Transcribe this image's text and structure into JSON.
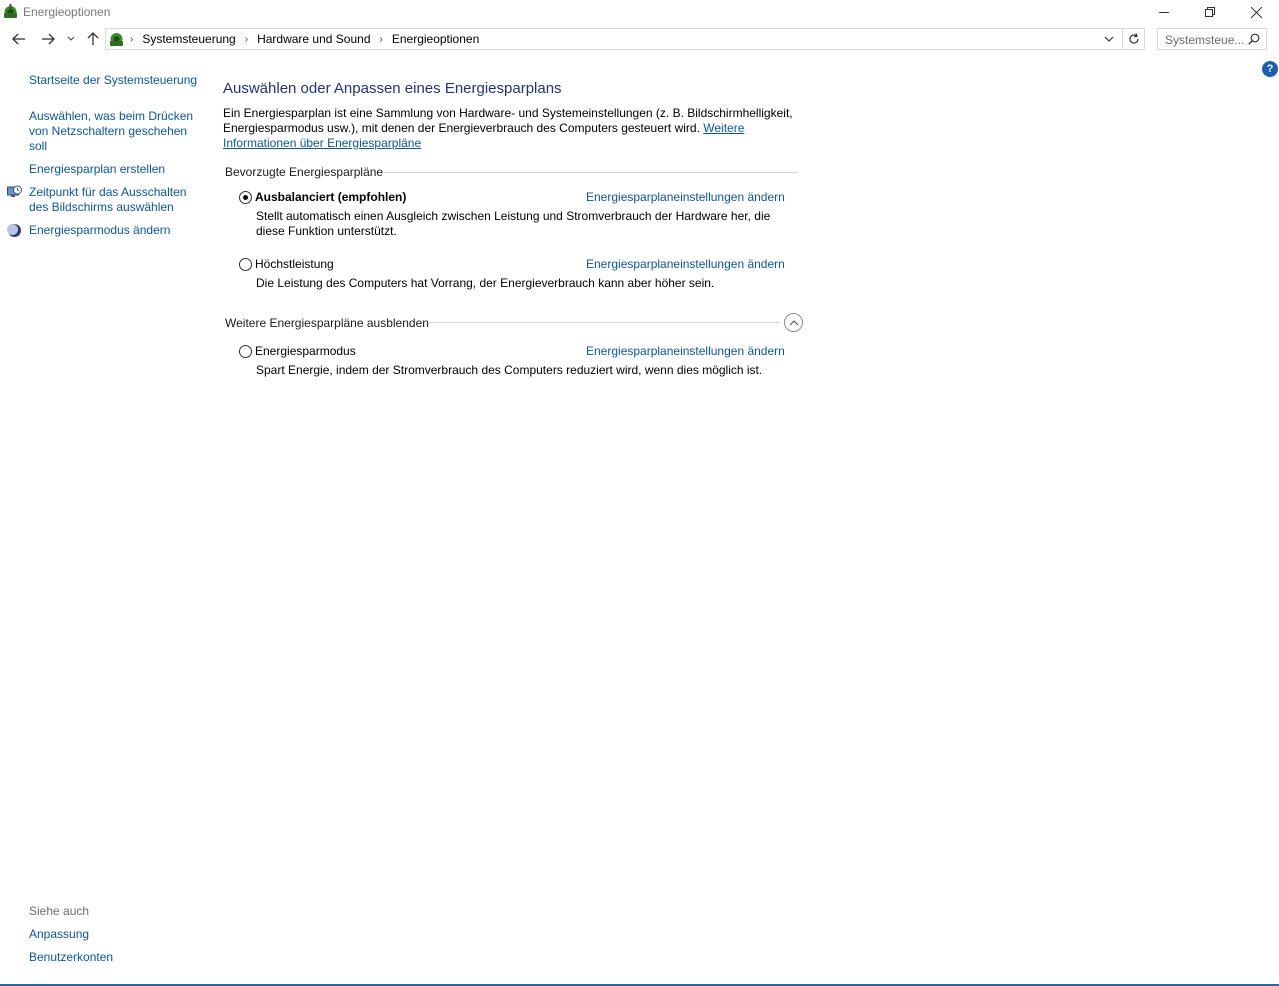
{
  "window": {
    "title": "Energieoptionen",
    "buttons": [
      "minimize",
      "restore",
      "close"
    ]
  },
  "address": {
    "crumbs": [
      "Systemsteuerung",
      "Hardware und Sound",
      "Energieoptionen"
    ]
  },
  "search": {
    "placeholder": "Systemsteue..."
  },
  "help": {
    "label": "?"
  },
  "sidebar": {
    "home": "Startseite der Systemsteuerung",
    "tasks": [
      {
        "label": "Auswählen, was beim Drücken von Netzschaltern geschehen soll",
        "icon": ""
      },
      {
        "label": "Energiesparplan erstellen",
        "icon": ""
      },
      {
        "label": "Zeitpunkt für das Ausschalten des Bildschirms auswählen",
        "icon": "monitor-clock-icon"
      },
      {
        "label": "Energiesparmodus ändern",
        "icon": "moon-icon"
      }
    ],
    "see_also": {
      "heading": "Siehe auch",
      "links": [
        "Anpassung",
        "Benutzerkonten"
      ]
    }
  },
  "main": {
    "title": "Auswählen oder Anpassen eines Energiesparplans",
    "intro": "Ein Energiesparplan ist eine Sammlung von Hardware- und Systemeinstellungen (z. B. Bildschirmhelligkeit, Energiesparmodus usw.), mit denen der Energieverbrauch des Computers gesteuert wird.",
    "intro_link": "Weitere Informationen über Energiesparpläne",
    "preferred_heading": "Bevorzugte Energiesparpläne",
    "more_heading": "Weitere Energiesparpläne ausblenden",
    "plans": [
      {
        "name": "Ausbalanciert (empfohlen)",
        "selected": true,
        "link": "Energiesparplaneinstellungen ändern",
        "desc": "Stellt automatisch einen Ausgleich zwischen Leistung und Stromverbrauch der Hardware her, die diese Funktion unterstützt."
      },
      {
        "name": "Höchstleistung",
        "selected": false,
        "link": "Energiesparplaneinstellungen ändern",
        "desc": "Die Leistung des Computers hat Vorrang, der Energieverbrauch kann aber höher sein."
      },
      {
        "name": "Energiesparmodus",
        "selected": false,
        "link": "Energiesparplaneinstellungen ändern",
        "desc": "Spart Energie, indem der Stromverbrauch des Computers reduziert wird, wenn dies möglich ist."
      }
    ]
  },
  "colors": {
    "link": "#0a56a8",
    "title": "#1e3287",
    "accent_bottom": "#1d6fa5"
  }
}
